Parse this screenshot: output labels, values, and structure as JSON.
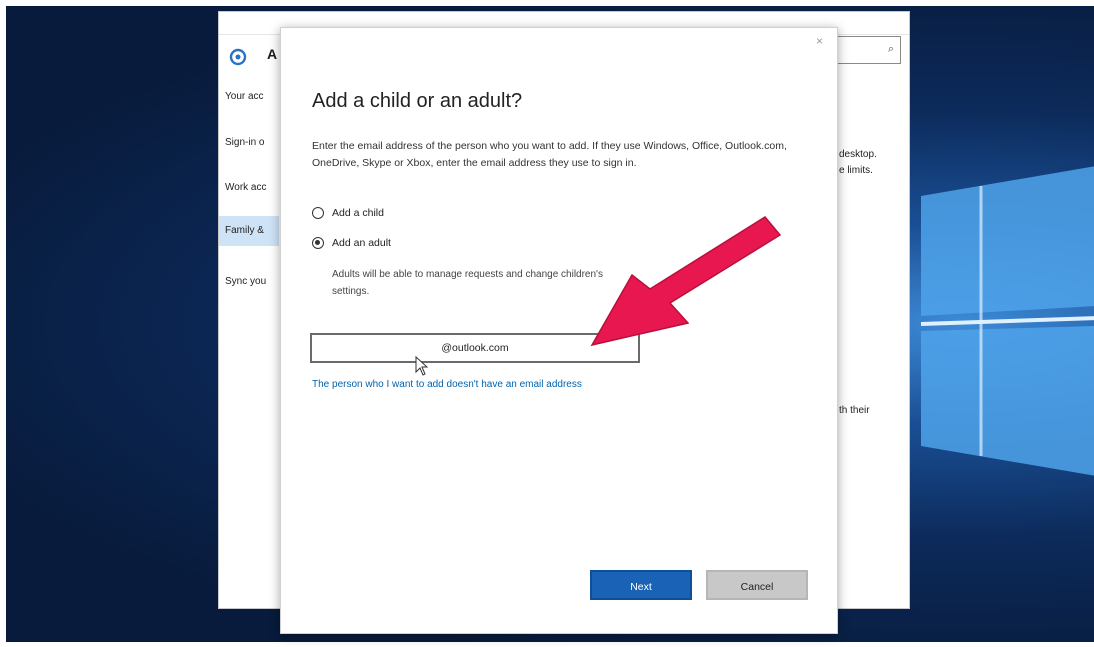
{
  "settings_window": {
    "heading_letter": "A",
    "search_icon": "search-icon",
    "nav_items": [
      "Your acc",
      "Sign-in o",
      "Work acc",
      "Family &",
      "Sync you"
    ],
    "selected_nav": "Family &",
    "side_texts": [
      "desktop.",
      "e limits.",
      "th their"
    ]
  },
  "dialog": {
    "title": "Add a child or an adult?",
    "description": "Enter the email address of the person who you want to add. If they use Windows, Office, Outlook.com, OneDrive, Skype or Xbox, enter the email address they use to sign in.",
    "options": [
      {
        "label": "Add a child",
        "checked": false
      },
      {
        "label": "Add an adult",
        "checked": true
      }
    ],
    "adult_note": "Adults will be able to manage requests and change children's settings.",
    "email_value": "@outlook.com",
    "no_email_link": "The person who I want to add doesn't have an email address",
    "next_label": "Next",
    "cancel_label": "Cancel",
    "close_icon": "close-icon"
  },
  "annotation": {
    "arrow_color": "#e8174f"
  },
  "colors": {
    "accent": "#1a62b5",
    "link": "#0063b1",
    "selected_nav_bg": "#cfe3f6"
  }
}
